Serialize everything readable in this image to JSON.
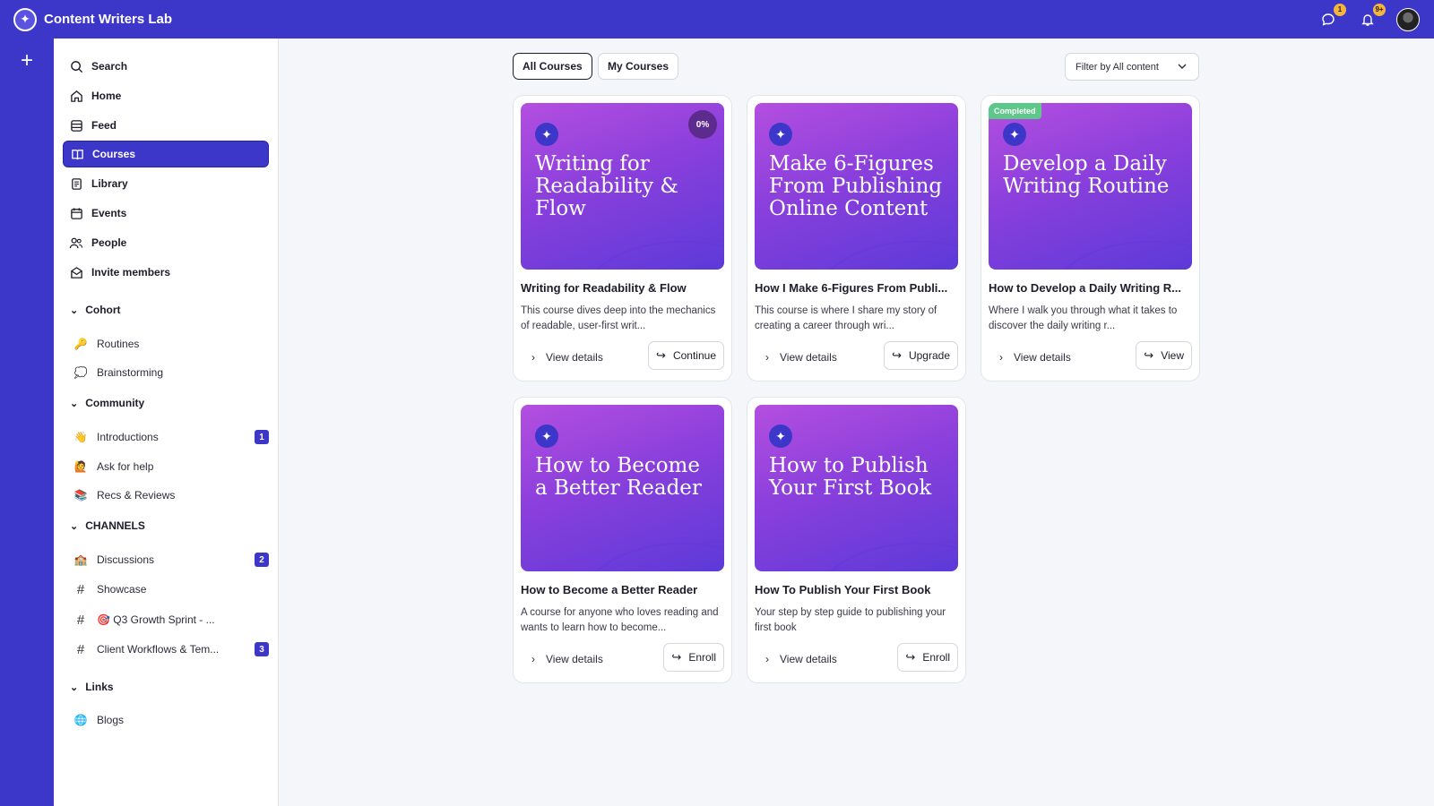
{
  "app": {
    "title": "Content Writers Lab"
  },
  "topbar": {
    "chat_badge": "1",
    "bell_badge": "9+"
  },
  "sidebar": {
    "nav": [
      {
        "label": "Search",
        "icon": "search-icon"
      },
      {
        "label": "Home",
        "icon": "home-icon"
      },
      {
        "label": "Feed",
        "icon": "feed-icon"
      },
      {
        "label": "Courses",
        "icon": "book-icon",
        "active": true
      },
      {
        "label": "Library",
        "icon": "library-icon"
      },
      {
        "label": "Events",
        "icon": "calendar-icon"
      },
      {
        "label": "People",
        "icon": "people-icon"
      },
      {
        "label": "Invite members",
        "icon": "envelope-icon"
      }
    ],
    "sections": [
      {
        "title": "Cohort",
        "items": [
          {
            "label": "Routines",
            "emoji": "🔑"
          },
          {
            "label": "Brainstorming",
            "emoji": "💭"
          }
        ]
      },
      {
        "title": "Community",
        "items": [
          {
            "label": "Introductions",
            "emoji": "👋",
            "badge": "1"
          },
          {
            "label": "Ask for help",
            "emoji": "🙋"
          },
          {
            "label": "Recs & Reviews",
            "emoji": "📚"
          }
        ]
      },
      {
        "title": "CHANNELS",
        "items": [
          {
            "label": "Discussions",
            "emoji": "🏫",
            "badge": "2"
          },
          {
            "label": "Showcase",
            "emoji": "#"
          },
          {
            "label": "🎯 Q3 Growth Sprint - ...",
            "emoji": "#"
          },
          {
            "label": "Client Workflows & Tem...",
            "emoji": "#",
            "badge": "3"
          }
        ]
      },
      {
        "title": "Links",
        "items": [
          {
            "label": "Blogs",
            "emoji": "🌐"
          }
        ]
      }
    ]
  },
  "main": {
    "tabs": [
      {
        "label": "All Courses",
        "active": true
      },
      {
        "label": "My Courses",
        "active": false
      }
    ],
    "filter": {
      "label": "Filter by All content"
    },
    "view_details_label": "View details",
    "courses": [
      {
        "thumb_title": "Writing for Readability & Flow",
        "title": "Writing for Readability & Flow",
        "desc": "This course dives deep into the mechanics of readable, user-first writ...",
        "action": "Continue",
        "progress": "0%",
        "status": ""
      },
      {
        "thumb_title": "Make 6-Figures From Publishing Online Content",
        "title": "How I Make 6-Figures From Publi...",
        "desc": "This course is where I share my story of creating a career through wri...",
        "action": "Upgrade",
        "progress": "",
        "status": ""
      },
      {
        "thumb_title": "Develop a Daily Writing Routine",
        "title": "How to Develop a Daily Writing R...",
        "desc": "Where I walk you through what it takes to discover the daily writing r...",
        "action": "View",
        "progress": "",
        "status": "Completed"
      },
      {
        "thumb_title": "How to Become a Better Reader",
        "title": "How to Become a Better Reader",
        "desc": "A course for anyone who loves reading and wants to learn how to become...",
        "action": "Enroll",
        "progress": "",
        "status": ""
      },
      {
        "thumb_title": "How to Publish Your First Book",
        "title": "How To Publish Your First Book",
        "desc": "Your step by step guide to publishing your first book",
        "action": "Enroll",
        "progress": "",
        "status": ""
      }
    ]
  }
}
